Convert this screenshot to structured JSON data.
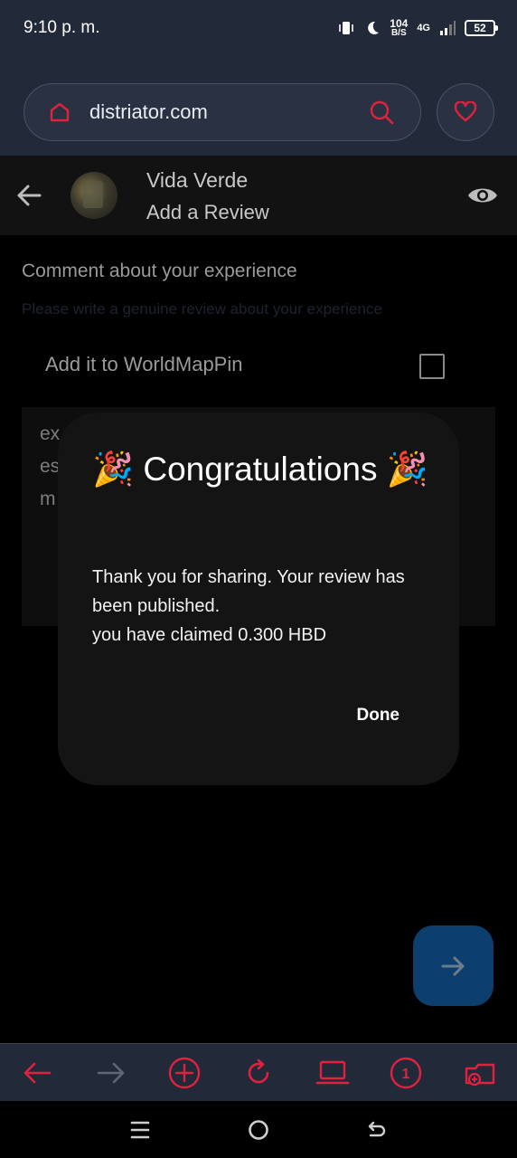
{
  "status_bar": {
    "time": "9:10 p. m.",
    "net_speed_value": "104",
    "net_speed_unit": "B/S",
    "network": "4G",
    "battery": "52",
    "icons": [
      "vibrate-icon",
      "moon-icon",
      "signal-icon",
      "battery-icon"
    ]
  },
  "browser": {
    "url": "distriator.com",
    "accent_color": "#e0223f"
  },
  "header": {
    "business_name": "Vida Verde",
    "subtitle": "Add a Review"
  },
  "form": {
    "comment_label": "Comment about your experience",
    "comment_hint": "Please write a genuine review about your experience",
    "worldmappin_label": "Add it to WorldMapPin",
    "worldmappin_checked": false,
    "textarea_lines": [
      "ex",
      "es",
      "m"
    ]
  },
  "dialog": {
    "title": "🎉 Congratulations 🎉",
    "message_line1": "Thank you for sharing. Your review has been published.",
    "message_line2": "you have claimed 0.300 HBD",
    "done_label": "Done"
  },
  "toolbar": {
    "tabs_count": "1",
    "icons": [
      "back-arrow-icon",
      "forward-arrow-icon",
      "add-tab-icon",
      "reload-icon",
      "desktop-icon",
      "tab-count-icon",
      "tabs-folder-icon"
    ]
  },
  "system_nav": {
    "icons": [
      "recents-icon",
      "home-icon",
      "back-icon"
    ]
  }
}
